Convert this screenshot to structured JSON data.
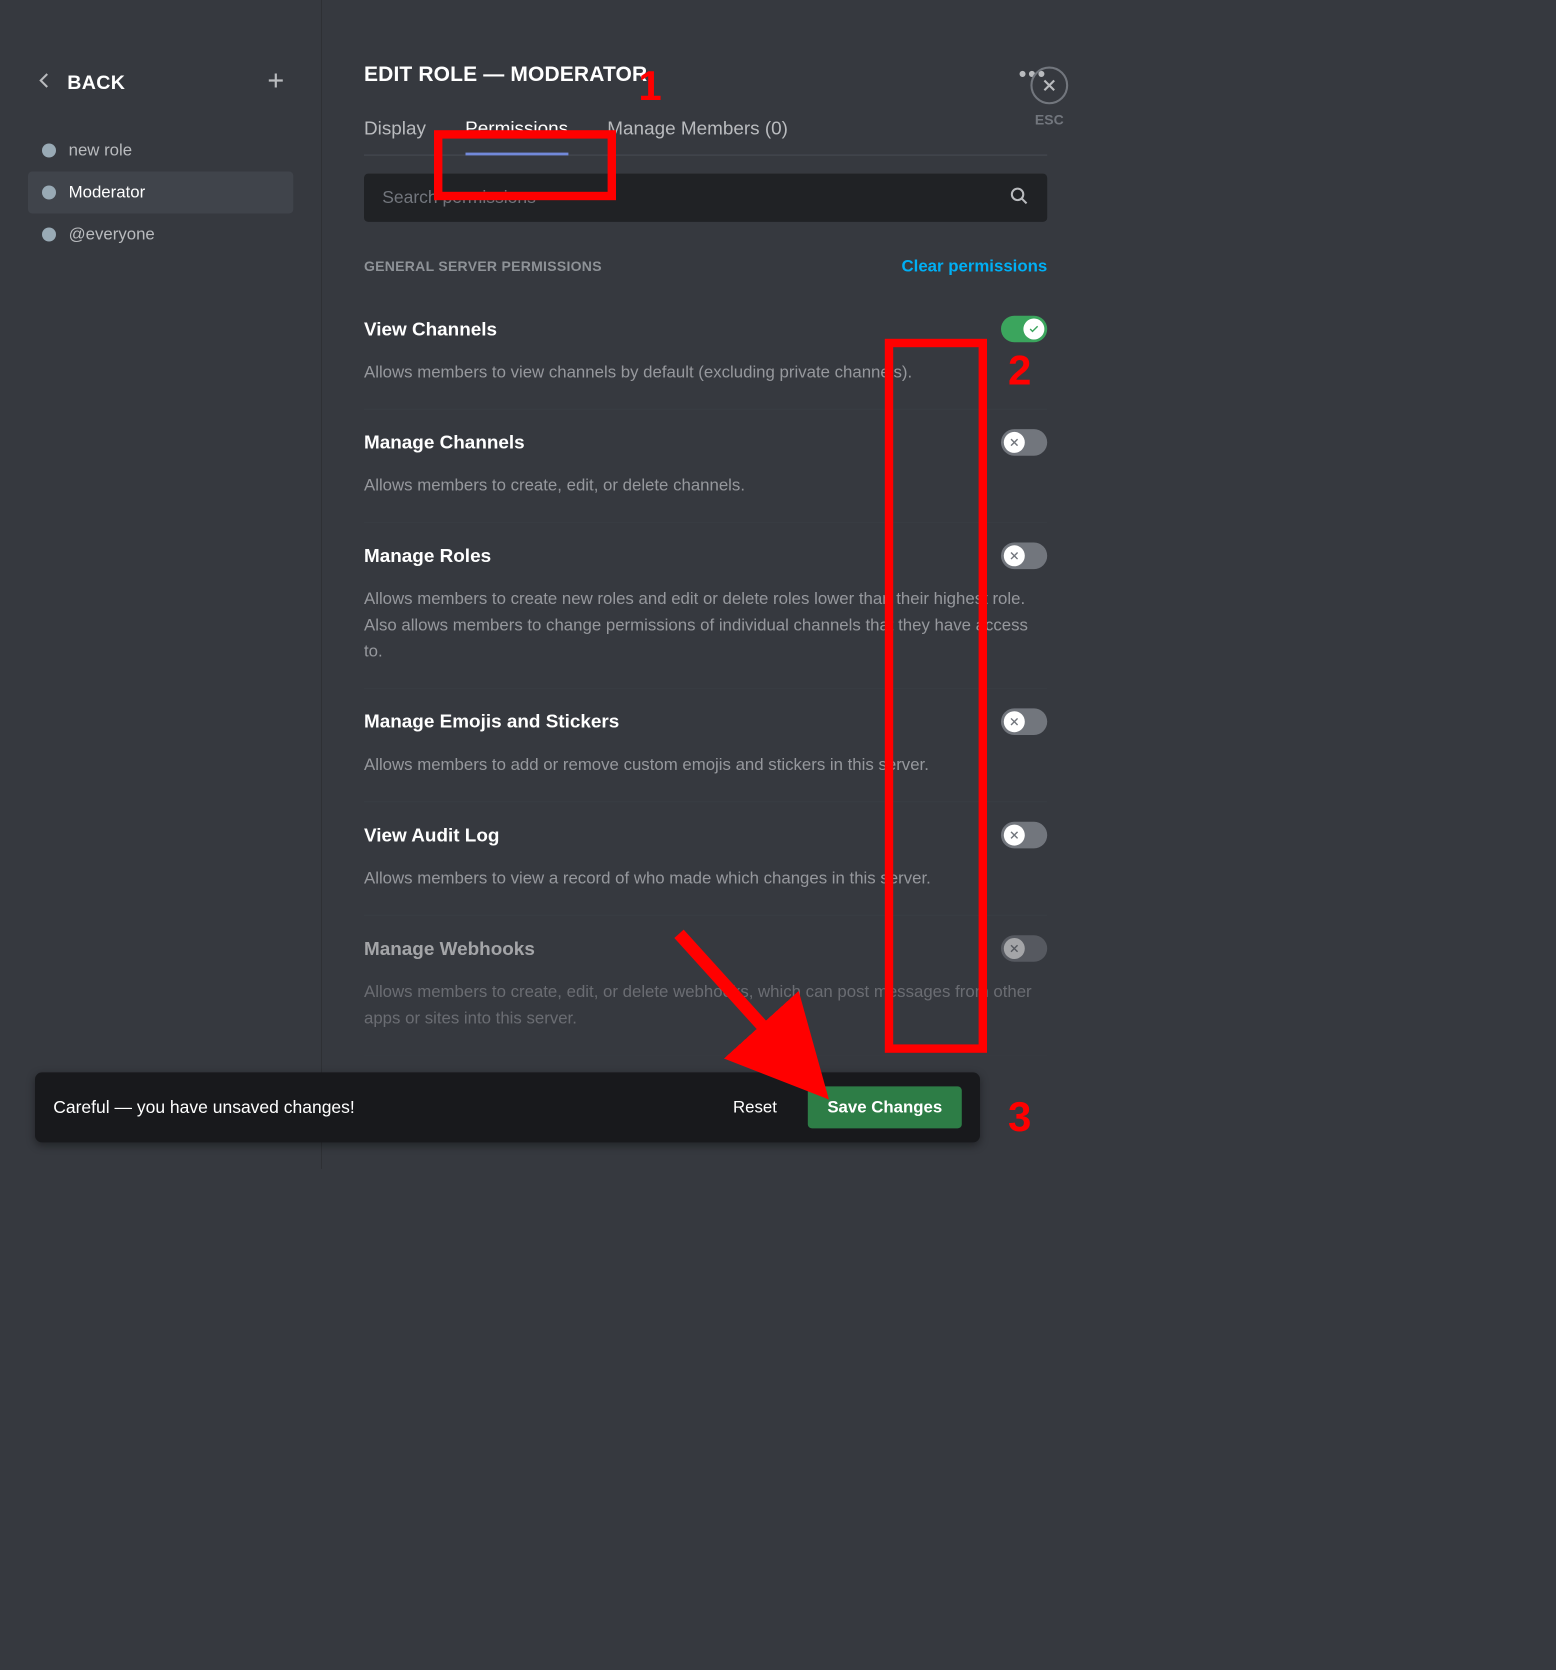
{
  "sidebar": {
    "back_label": "BACK",
    "roles": [
      {
        "name": "new role"
      },
      {
        "name": "Moderator",
        "selected": true
      },
      {
        "name": "@everyone"
      }
    ]
  },
  "header": {
    "title": "EDIT ROLE — MODERATOR"
  },
  "tabs": {
    "display": "Display",
    "permissions": "Permissions",
    "manage_members": "Manage Members (0)"
  },
  "search": {
    "placeholder": "Search permissions"
  },
  "section": {
    "label": "GENERAL SERVER PERMISSIONS",
    "clear": "Clear permissions"
  },
  "permissions": [
    {
      "title": "View Channels",
      "desc": "Allows members to view channels by default (excluding private channels).",
      "on": true
    },
    {
      "title": "Manage Channels",
      "desc": "Allows members to create, edit, or delete channels.",
      "on": false
    },
    {
      "title": "Manage Roles",
      "desc": "Allows members to create new roles and edit or delete roles lower than their highest role. Also allows members to change permissions of individual channels that they have access to.",
      "on": false
    },
    {
      "title": "Manage Emojis and Stickers",
      "desc": "Allows members to add or remove custom emojis and stickers in this server.",
      "on": false
    },
    {
      "title": "View Audit Log",
      "desc": "Allows members to view a record of who made which changes in this server.",
      "on": false
    },
    {
      "title": "Manage Webhooks",
      "desc": "Allows members to create, edit, or delete webhooks, which can post messages from other apps or sites into this server.",
      "on": false
    }
  ],
  "unsaved": {
    "message": "Careful — you have unsaved changes!",
    "reset": "Reset",
    "save": "Save Changes"
  },
  "close": {
    "esc": "ESC"
  },
  "annotations": {
    "n1": "1",
    "n2": "2",
    "n3": "3"
  }
}
